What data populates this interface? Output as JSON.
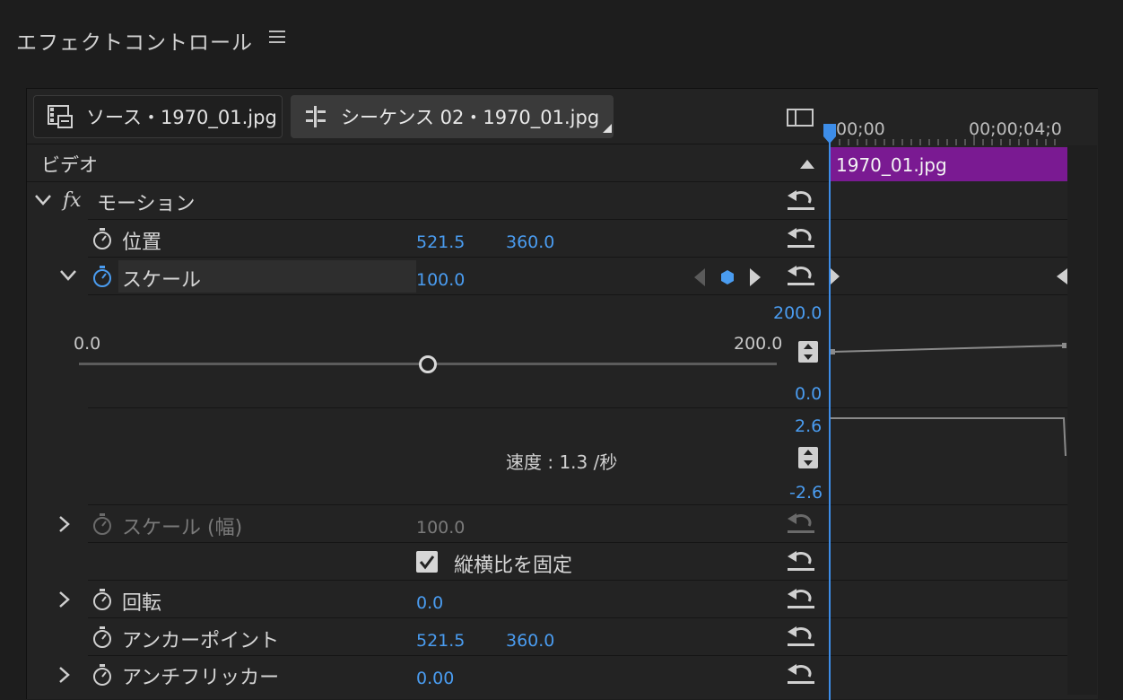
{
  "panel": {
    "title": "エフェクトコントロール"
  },
  "tabs": {
    "source": "ソース・1970_01.jpg",
    "sequence": "シーケンス 02・1970_01.jpg"
  },
  "timeline": {
    "start_time": "00;00",
    "end_time": "00;00;04;0",
    "clip_name": "1970_01.jpg"
  },
  "section": {
    "video": "ビデオ"
  },
  "effect": {
    "fx": "fx",
    "name": "モーション"
  },
  "params": {
    "position": {
      "label": "位置",
      "x": "521.5",
      "y": "360.0"
    },
    "scale": {
      "label": "スケール",
      "value": "100.0",
      "graph_top": "200.0",
      "graph_bottom": "0.0",
      "slider_min": "0.0",
      "slider_max": "200.0",
      "slider_position": 0.5,
      "velocity_top": "2.6",
      "velocity_bottom": "-2.6",
      "velocity_text": "速度 : 1.3 /秒"
    },
    "scale_width": {
      "label": "スケール (幅)",
      "value": "100.0"
    },
    "uniform": {
      "label": "縦横比を固定",
      "checked": true
    },
    "rotation": {
      "label": "回転",
      "value": "0.0"
    },
    "anchor": {
      "label": "アンカーポイント",
      "x": "521.5",
      "y": "360.0"
    },
    "flicker": {
      "label": "アンチフリッカー",
      "value": "0.00"
    }
  },
  "colors": {
    "accent": "#4a9cf0",
    "clip": "#7a1a92",
    "playhead": "#3d8de8"
  }
}
